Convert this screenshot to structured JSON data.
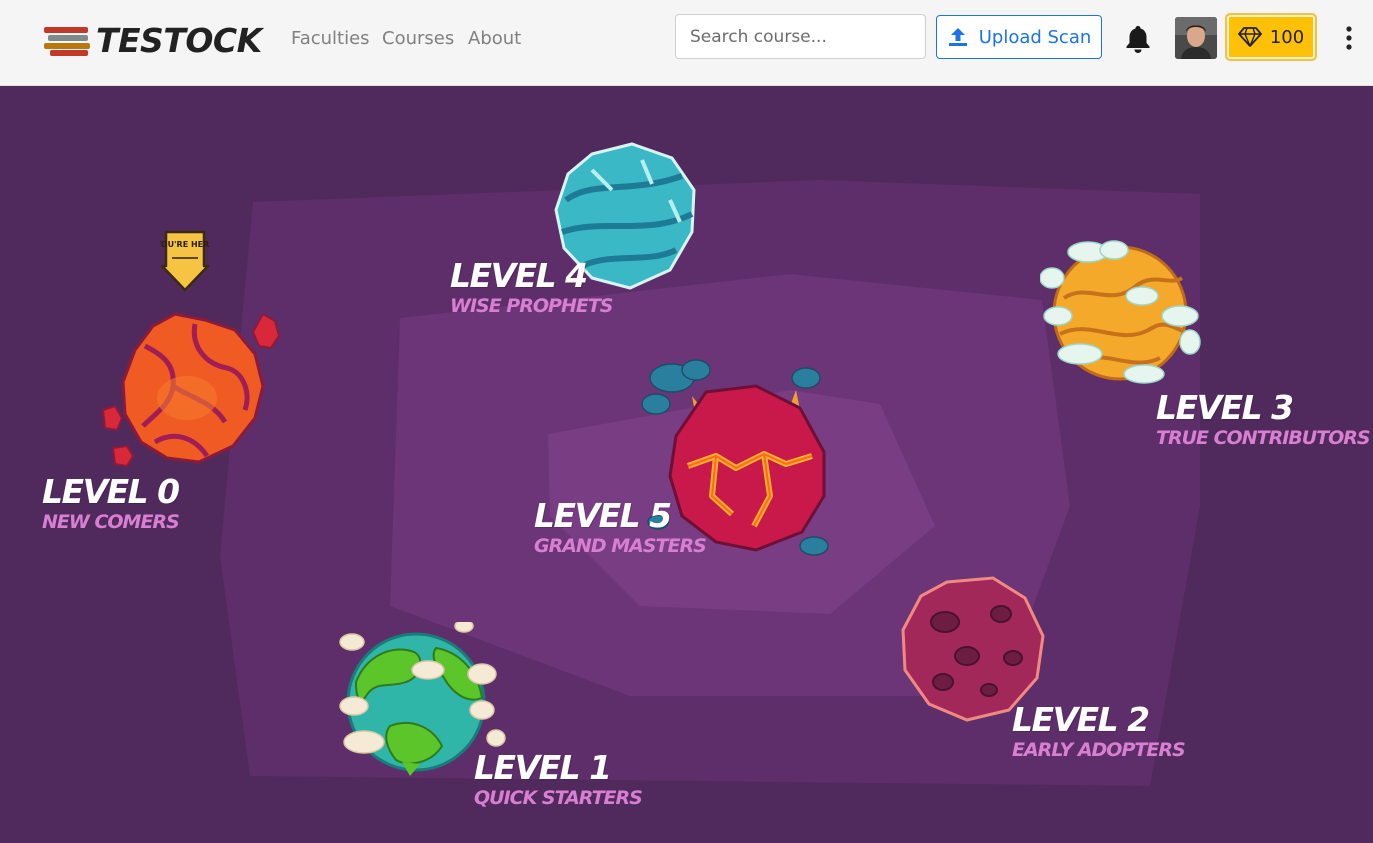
{
  "brand": {
    "name": "TESTOCK"
  },
  "nav": {
    "links": [
      "Faculties",
      "Courses",
      "About"
    ]
  },
  "search": {
    "placeholder": "Search course..."
  },
  "upload": {
    "label": "Upload Scan",
    "icon": "upload-icon"
  },
  "notifications": {
    "icon": "bell-icon"
  },
  "gems": {
    "count": "100",
    "icon": "diamond-icon"
  },
  "menu": {
    "icon": "kebab-menu-icon"
  },
  "map": {
    "you_are_here": "YOU'RE HERE",
    "levels": [
      {
        "title": "LEVEL 0",
        "subtitle": "NEW COMERS"
      },
      {
        "title": "LEVEL 1",
        "subtitle": "QUICK STARTERS"
      },
      {
        "title": "LEVEL 2",
        "subtitle": "EARLY ADOPTERS"
      },
      {
        "title": "LEVEL 3",
        "subtitle": "TRUE CONTRIBUTORS"
      },
      {
        "title": "LEVEL 4",
        "subtitle": "WISE PROPHETS"
      },
      {
        "title": "LEVEL 5",
        "subtitle": "GRAND MASTERS"
      }
    ]
  },
  "colors": {
    "accent": "#1a73e8",
    "gem_button": "#ffc107",
    "map_background": "#512a5d",
    "level_subtitle": "#d87fd2"
  }
}
